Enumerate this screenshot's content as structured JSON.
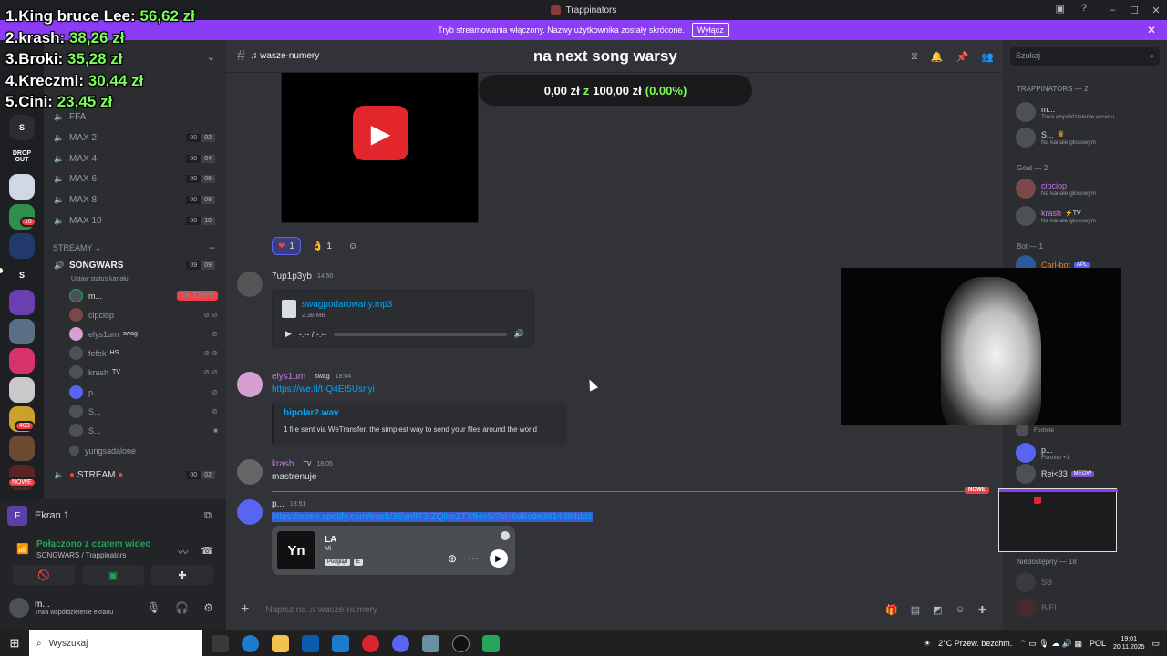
{
  "window": {
    "title": "Trappinators",
    "banner_text": "Tryb streamowania włączony. Nazwy użytkownika zostały skrócone.",
    "banner_button": "Wyłącz"
  },
  "overlay": {
    "leaderboard": [
      {
        "rank": "1.",
        "name": "King bruce Lee:",
        "amount": "56,62 zł"
      },
      {
        "rank": "2.",
        "name": "krash:",
        "amount": "38,26 zł"
      },
      {
        "rank": "3.",
        "name": "Broki:",
        "amount": "35,28 zł"
      },
      {
        "rank": "4.",
        "name": "Kreczmi:",
        "amount": "30,44 zł"
      },
      {
        "rank": "5.",
        "name": "Cini:",
        "amount": "23,45 zł"
      }
    ]
  },
  "rail": {
    "servers": [
      {
        "label": "S"
      },
      {
        "label": "DROP OUT"
      },
      {
        "label": ""
      },
      {
        "label": "",
        "badge": "10"
      },
      {
        "label": ""
      },
      {
        "label": "S"
      },
      {
        "label": ""
      },
      {
        "label": ""
      },
      {
        "label": ""
      },
      {
        "label": ""
      },
      {
        "label": "",
        "badge": "403"
      },
      {
        "label": ""
      },
      {
        "label": "",
        "badge": "NOWE"
      }
    ]
  },
  "sidebar": {
    "channels": [
      {
        "name": "FFA",
        "icon": "speaker-icon"
      },
      {
        "name": "MAX 2",
        "icon": "speaker-icon",
        "limit": [
          "00",
          "02"
        ]
      },
      {
        "name": "MAX 4",
        "icon": "speaker-icon",
        "limit": [
          "00",
          "04"
        ]
      },
      {
        "name": "MAX 6",
        "icon": "speaker-icon",
        "limit": [
          "00",
          "06"
        ]
      },
      {
        "name": "MAX 8",
        "icon": "speaker-icon",
        "limit": [
          "00",
          "08"
        ]
      },
      {
        "name": "MAX 10",
        "icon": "speaker-icon",
        "limit": [
          "00",
          "10"
        ]
      }
    ],
    "streamy_category": "STREAMY",
    "songwars": {
      "name": "SONGWARS",
      "limit": [
        "09",
        "09"
      ],
      "status": "Ustaw status kanału"
    },
    "voice_users": [
      {
        "name": "m...",
        "live": "NA ŻYWO"
      },
      {
        "name": "cipciop"
      },
      {
        "name": "elys1um",
        "tag": "swag"
      },
      {
        "name": "fefek",
        "tag": "HS"
      },
      {
        "name": "krash",
        "tag": "TV"
      },
      {
        "name": "p..."
      },
      {
        "name": "S..."
      },
      {
        "name": "S..."
      },
      {
        "name": "yungsadalone"
      }
    ],
    "stream_channel": {
      "name": "STREAM",
      "limit": [
        "00",
        "02"
      ]
    }
  },
  "user_panel": {
    "screen_share": "Ekran 1",
    "connected": "Połączono z czatem wideo",
    "connected_sub": "SONGWARS / Trappinators",
    "username": "m...",
    "user_status": "Trwa współdzielenie ekranu"
  },
  "chat": {
    "channel_name": "♫ wasze-numery",
    "overlay_title": "na next song warsy",
    "goal": {
      "current": "0,00 zł",
      "sep": "z",
      "target": "100,00 zł",
      "pct": "(0.00%)"
    },
    "reactions": [
      {
        "emoji": "❤",
        "count": "1"
      },
      {
        "emoji": "👌",
        "count": "1"
      }
    ],
    "messages": [
      {
        "author": "7up1p3yb",
        "time": "14:50",
        "color": "#dbdee1",
        "file": {
          "name": "swagpodarowany.mp3",
          "size": "2.38 MB",
          "time": "-:-- / -:--"
        }
      },
      {
        "author": "elys1um",
        "tag": "swag",
        "time": "18:04",
        "color": "#c27be0",
        "link": "https://we.tl/t-Q4Et5Usnyi",
        "embed": {
          "title": "bipolar2.wav",
          "desc": "1 file sent via WeTransfer, the simplest way to send your files around the world"
        }
      },
      {
        "author": "krash",
        "tag": "TV",
        "time": "18:05",
        "color": "#c27be0",
        "text": "mastrenuje"
      },
      {
        "author": "p...",
        "time": "18:51",
        "color": "#dbdee1",
        "link": "https://open.spotify.com/track/3EynlIT3tZQihoZTXfHnSi?si=6d6c9e3814d84dd1",
        "spotify": {
          "title": "LA",
          "artist": "Mi",
          "badges": [
            "Podgląd",
            "E"
          ]
        }
      }
    ],
    "new_tag": "NOWE",
    "input_placeholder": "Napisz na ♫ wasze-numery"
  },
  "members": {
    "search_placeholder": "Szukaj",
    "groups": [
      {
        "label": "TRAPPINATORS — 2",
        "items": [
          {
            "name": "m...",
            "status": "Trwa współdzielenie ekranu"
          },
          {
            "name": "S...",
            "status": "Na kanale głosowym"
          }
        ]
      },
      {
        "label": "Goat — 2",
        "items": [
          {
            "name": "cipciop",
            "status": "Na kanale głosowym"
          },
          {
            "name": "krash",
            "status": "Na kanale głosowym"
          }
        ]
      },
      {
        "label": "Bot — 1",
        "items": [
          {
            "name": "Carl-bot",
            "status": "",
            "tag": "APL"
          }
        ]
      }
    ],
    "lower": [
      {
        "name": "",
        "status": "Fortnite"
      },
      {
        "name": "p...",
        "status": "Fortnite +1"
      },
      {
        "name": "Rei<33",
        "tag": "MEOW"
      }
    ],
    "offline_label": "Niedostępny — 18",
    "offline": [
      "SB",
      "B/EL"
    ]
  },
  "taskbar": {
    "search": "Wyszukaj",
    "weather": "2°C  Przew. bezchm.",
    "lang": "POL",
    "time": "19:01",
    "date": "20.11.2025"
  },
  "colors": {
    "accent": "#8c3cf7",
    "live": "#f23f43",
    "link": "#00a8fc",
    "goal": "#7cfc5a"
  }
}
